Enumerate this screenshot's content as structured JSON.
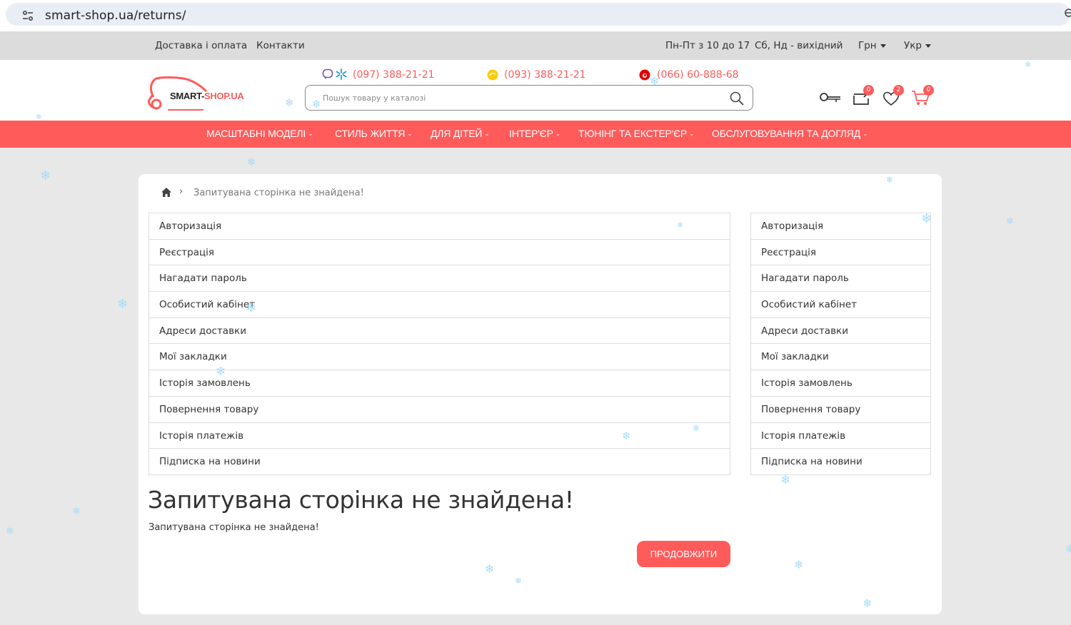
{
  "browser": {
    "url": "smart-shop.ua/returns/"
  },
  "topbar": {
    "links": [
      "Доставка і оплата",
      "Контакти"
    ],
    "hours_weekdays": "Пн-Пт з 10 до 17",
    "hours_weekend": "Сб, Нд - вихідний",
    "currency": "Грн",
    "language": "Укр"
  },
  "header": {
    "logo_main": "SMART-",
    "logo_accent": "SHOP.UA",
    "phones": [
      "(097) 388-21-21",
      "(093) 388-21-21",
      "(066) 60-888-68"
    ],
    "search_placeholder": "Пошук товару у каталозі",
    "compare_count": "0",
    "wishlist_count": "2",
    "cart_count": "0"
  },
  "nav": {
    "items": [
      "МАСШТАБНІ МОДЕЛІ",
      "СТИЛЬ ЖИТТЯ",
      "ДЛЯ ДІТЕЙ",
      "ІНТЕР'ЄР",
      "ТЮНІНГ ТА ЕКСТЕР'ЄР",
      "ОБСЛУГОВУВАННЯ ТА ДОГЛЯД"
    ]
  },
  "breadcrumb": {
    "current": "Запитувана сторінка не знайдена!"
  },
  "account_menu": {
    "items": [
      "Авторизація",
      "Реєстрація",
      "Нагадати пароль",
      "Особистий кабінет",
      "Адреси доставки",
      "Мої закладки",
      "Історія замовлень",
      "Повернення товару",
      "Історія платежів",
      "Підписка на новини"
    ]
  },
  "main": {
    "heading": "Запитувана сторінка не знайдена!",
    "message": "Запитувана сторінка не знайдена!",
    "continue_label": "ПРОДОВЖИТИ"
  },
  "colors": {
    "accent": "#ff5b5b",
    "topbar": "#dcdcdc",
    "page_bg": "#e8e8e8",
    "snow": "#a8dcf8"
  }
}
